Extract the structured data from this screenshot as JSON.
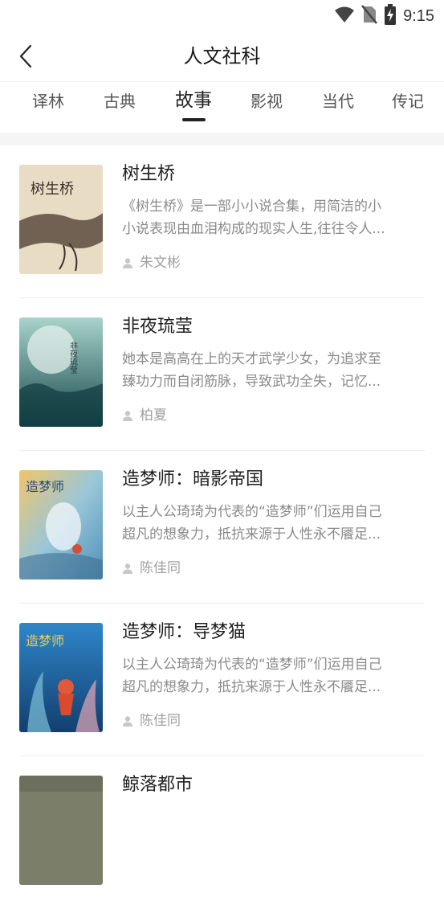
{
  "status_bar": {
    "time": "9:15"
  },
  "header": {
    "title": "人文社科"
  },
  "tabs": [
    {
      "label": "译林"
    },
    {
      "label": "古典"
    },
    {
      "label": "故事"
    },
    {
      "label": "影视"
    },
    {
      "label": "当代"
    },
    {
      "label": "传记"
    }
  ],
  "active_tab": "故事",
  "books": [
    {
      "title": "树生桥",
      "desc_line1": "《树生桥》是一部小小说合集，用简洁的小",
      "desc_line2": "小说表现由血泪构成的现实人生,往往令人...",
      "author": "朱文彬",
      "cover_text": "树生桥",
      "cover_colors": {
        "bg": "#e9dcc4",
        "accent": "#3a2f2a"
      }
    },
    {
      "title": "非夜琉莹",
      "desc_line1": "她本是高高在上的天才武学少女，为追求至",
      "desc_line2": "臻功力而自闭筋脉，导致武功全失，记忆...",
      "author": "柏夏",
      "cover_text": "非夜琉莹",
      "cover_colors": {
        "bg": "#2c6d6a",
        "accent": "#d8ece4"
      }
    },
    {
      "title": "造梦师：暗影帝国",
      "desc_line1": "以主人公琦琦为代表的“造梦师”们运用自己",
      "desc_line2": "超凡的想象力，抵抗来源于人性永不餍足...",
      "author": "陈佳同",
      "cover_text": "造梦师",
      "cover_colors": {
        "bg": "#e6b35c",
        "accent": "#4f8fb8"
      }
    },
    {
      "title": "造梦师：导梦猫",
      "desc_line1": "以主人公琦琦为代表的“造梦师”们运用自己",
      "desc_line2": "超凡的想象力，抵抗来源于人性永不餍足...",
      "author": "陈佳同",
      "cover_text": "造梦师",
      "cover_colors": {
        "bg": "#2a78b8",
        "accent": "#e05a3a"
      }
    },
    {
      "title": "鲸落都市",
      "desc_line1": "",
      "desc_line2": "",
      "author": "",
      "cover_text": "",
      "cover_colors": {
        "bg": "#7b7e68",
        "accent": "#55584a"
      }
    }
  ]
}
